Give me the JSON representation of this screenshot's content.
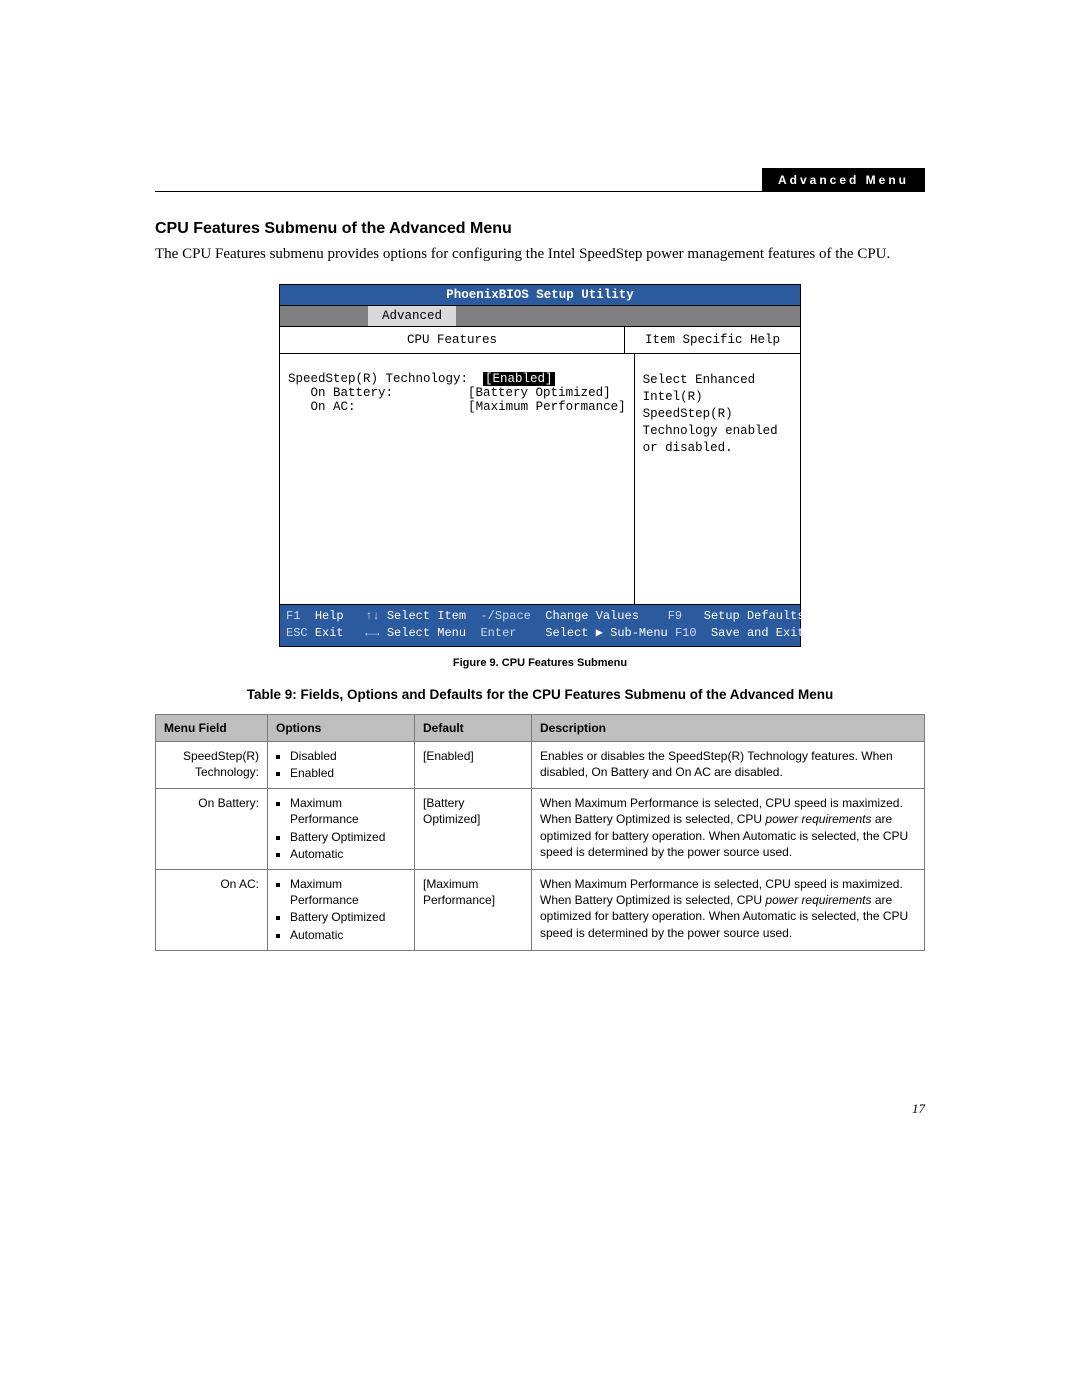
{
  "header_badge": "Advanced Menu",
  "section_title": "CPU Features Submenu of the Advanced Menu",
  "intro_paragraph": "The CPU Features submenu provides options for configuring the Intel SpeedStep power management features of the CPU.",
  "bios": {
    "title": "PhoenixBIOS Setup Utility",
    "tab_pre_spacer": "",
    "active_tab": "Advanced",
    "left_heading": "CPU Features",
    "right_heading": "Item Specific Help",
    "line1_label": "SpeedStep(R) Technology:",
    "line1_value": "[Enabled]",
    "line2_label": "On Battery:",
    "line2_value": "[Battery Optimized]",
    "line3_label": "On AC:",
    "line3_value": "[Maximum Performance]",
    "help_text": "Select Enhanced Intel(R) SpeedStep(R) Technology enabled or disabled.",
    "footer": {
      "f1": "F1",
      "help": "Help",
      "arrows_ud": "↑↓",
      "select_item": "Select Item",
      "minus_space": "-/Space",
      "change_values": "Change Values",
      "f9": "F9",
      "setup_defaults": "Setup Defaults",
      "esc": "ESC",
      "exit": "Exit",
      "arrows_lr": "←→",
      "select_menu": "Select Menu",
      "enter": "Enter",
      "select_sub": "Select ▶ Sub-Menu",
      "f10": "F10",
      "save_exit": "Save and Exit"
    }
  },
  "figure_caption": "Figure 9.  CPU Features Submenu",
  "table_title": "Table 9: Fields, Options and Defaults for the CPU Features Submenu of the Advanced Menu",
  "table": {
    "headers": {
      "menu_field": "Menu Field",
      "options": "Options",
      "default": "Default",
      "description": "Description"
    },
    "rows": [
      {
        "menu_field": "SpeedStep(R) Technology:",
        "options": [
          "Disabled",
          "Enabled"
        ],
        "default": "[Enabled]",
        "description_plain": "Enables or disables the SpeedStep(R) Technology features. When disabled, On Battery and On AC are disabled."
      },
      {
        "menu_field": "On Battery:",
        "options": [
          "Maximum Performance",
          "Battery Optimized",
          "Automatic"
        ],
        "default": "[Battery Optimized]",
        "desc_pre": "When Maximum Performance is selected, CPU speed is maximized. When Battery Optimized is selected, CPU ",
        "desc_italic": "power requirements",
        "desc_post": " are optimized for battery operation. When Automatic is selected, the CPU speed is determined by the power source used."
      },
      {
        "menu_field": "On AC:",
        "options": [
          "Maximum Performance",
          "Battery Optimized",
          "Automatic"
        ],
        "default": "[Maximum Performance]",
        "desc_pre": "When Maximum Performance is selected, CPU speed is maximized. When Battery Optimized is selected, CPU ",
        "desc_italic": "power requirements",
        "desc_post": " are optimized for battery operation. When Automatic is selected, the CPU speed is determined by the power source used."
      }
    ]
  },
  "page_number": "17"
}
